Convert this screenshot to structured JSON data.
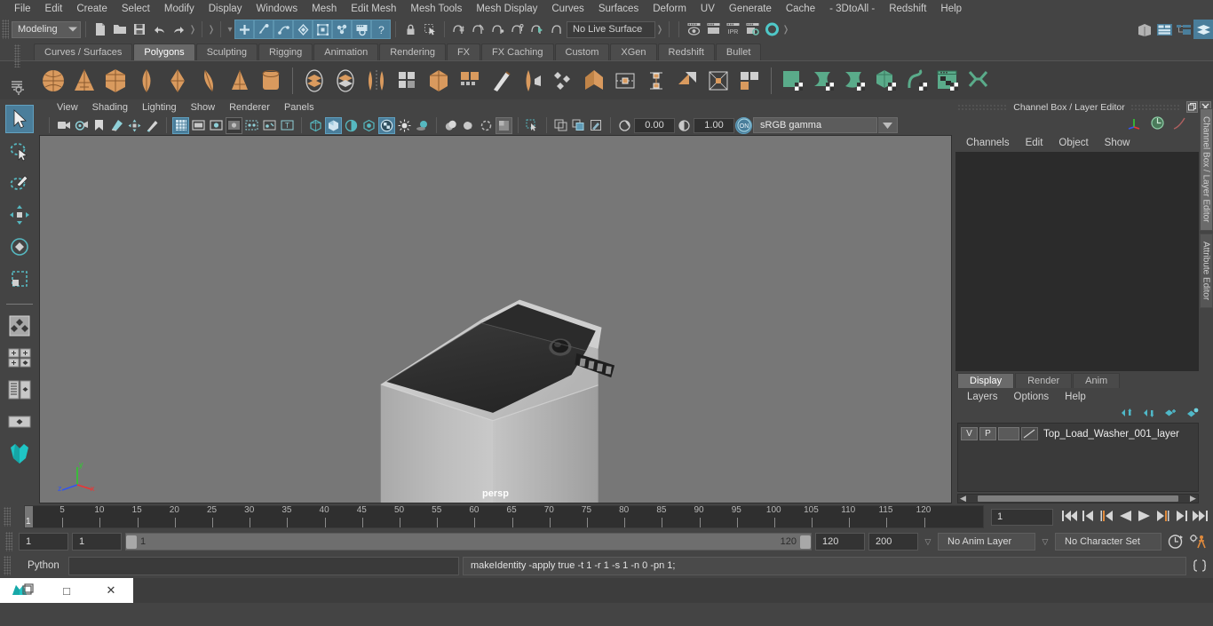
{
  "menubar": {
    "items": [
      "File",
      "Edit",
      "Create",
      "Select",
      "Modify",
      "Display",
      "Windows",
      "Mesh",
      "Edit Mesh",
      "Mesh Tools",
      "Mesh Display",
      "Curves",
      "Surfaces",
      "Deform",
      "UV",
      "Generate",
      "Cache",
      "- 3DtoAll -",
      "Redshift",
      "Help"
    ]
  },
  "statusline": {
    "menuset": "Modeling",
    "live_surface": "No Live Surface"
  },
  "shelf": {
    "tabs": [
      "Curves / Surfaces",
      "Polygons",
      "Sculpting",
      "Rigging",
      "Animation",
      "Rendering",
      "FX",
      "FX Caching",
      "Custom",
      "XGen",
      "Redshift",
      "Bullet"
    ],
    "active_tab": "Polygons"
  },
  "viewport": {
    "menus": [
      "View",
      "Shading",
      "Lighting",
      "Show",
      "Renderer",
      "Panels"
    ],
    "exposure": "0.00",
    "gamma": "1.00",
    "color_space": "sRGB gamma",
    "camera_label": "persp",
    "axis": {
      "x": "x",
      "y": "y",
      "z": "z"
    }
  },
  "channelbox": {
    "title": "Channel Box / Layer Editor",
    "menus": [
      "Channels",
      "Edit",
      "Object",
      "Show"
    ]
  },
  "layereditor": {
    "tabs": [
      "Display",
      "Render",
      "Anim"
    ],
    "active_tab": "Display",
    "menus": [
      "Layers",
      "Options",
      "Help"
    ],
    "layers": [
      {
        "visibility": "V",
        "playback": "P",
        "name": "Top_Load_Washer_001_layer"
      }
    ]
  },
  "vertical_tabs": [
    "Channel Box / Layer Editor",
    "Attribute Editor"
  ],
  "timeline": {
    "ticks": [
      5,
      10,
      15,
      20,
      25,
      30,
      35,
      40,
      45,
      50,
      55,
      60,
      65,
      70,
      75,
      80,
      85,
      90,
      95,
      100,
      105,
      110,
      115,
      120
    ],
    "current_frame_label": "1",
    "frame_input": "1"
  },
  "rangebar": {
    "start": "1",
    "end": "1",
    "range_start_label": "1",
    "range_end_label": "120",
    "playback_start": "120",
    "playback_end": "200",
    "anim_layer": "No Anim Layer",
    "character_set": "No Character Set"
  },
  "commandline": {
    "language": "Python",
    "input_value": "",
    "output": "makeIdentity -apply true -t 1 -r 1 -s 1 -n 0 -pn 1;"
  },
  "taskbar": {
    "restore": "❐",
    "maximize": "□",
    "close": "✕"
  },
  "colors": {
    "accent_blue": "#4a7e9b",
    "shelf_orange": "#d99a5e",
    "shelf_green": "#5aab8a",
    "background": "#444444",
    "viewport_bg": "#777777"
  }
}
